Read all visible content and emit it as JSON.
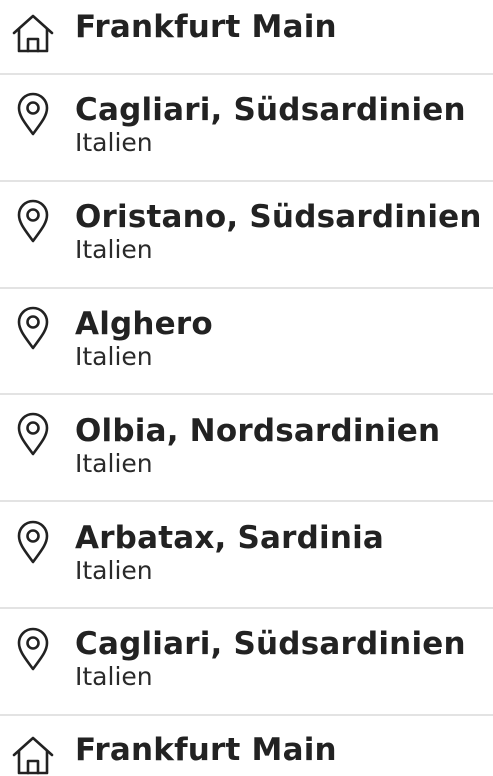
{
  "list": {
    "items": [
      {
        "kind": "home",
        "icon": "home-icon",
        "title": "Frankfurt Main",
        "subtitle": ""
      },
      {
        "kind": "place",
        "icon": "location-pin-icon",
        "title": "Cagliari, Südsardinien",
        "subtitle": "Italien"
      },
      {
        "kind": "place",
        "icon": "location-pin-icon",
        "title": "Oristano, Südsardinien",
        "subtitle": "Italien"
      },
      {
        "kind": "place",
        "icon": "location-pin-icon",
        "title": "Alghero",
        "subtitle": "Italien"
      },
      {
        "kind": "place",
        "icon": "location-pin-icon",
        "title": "Olbia, Nordsardinien",
        "subtitle": "Italien"
      },
      {
        "kind": "place",
        "icon": "location-pin-icon",
        "title": "Arbatax, Sardinia",
        "subtitle": "Italien"
      },
      {
        "kind": "place",
        "icon": "location-pin-icon",
        "title": "Cagliari, Südsardinien",
        "subtitle": "Italien"
      },
      {
        "kind": "home",
        "icon": "home-icon",
        "title": "Frankfurt Main",
        "subtitle": ""
      }
    ]
  },
  "colors": {
    "text": "#222222",
    "divider": "#e3e3e3",
    "icon_stroke": "#222222"
  }
}
